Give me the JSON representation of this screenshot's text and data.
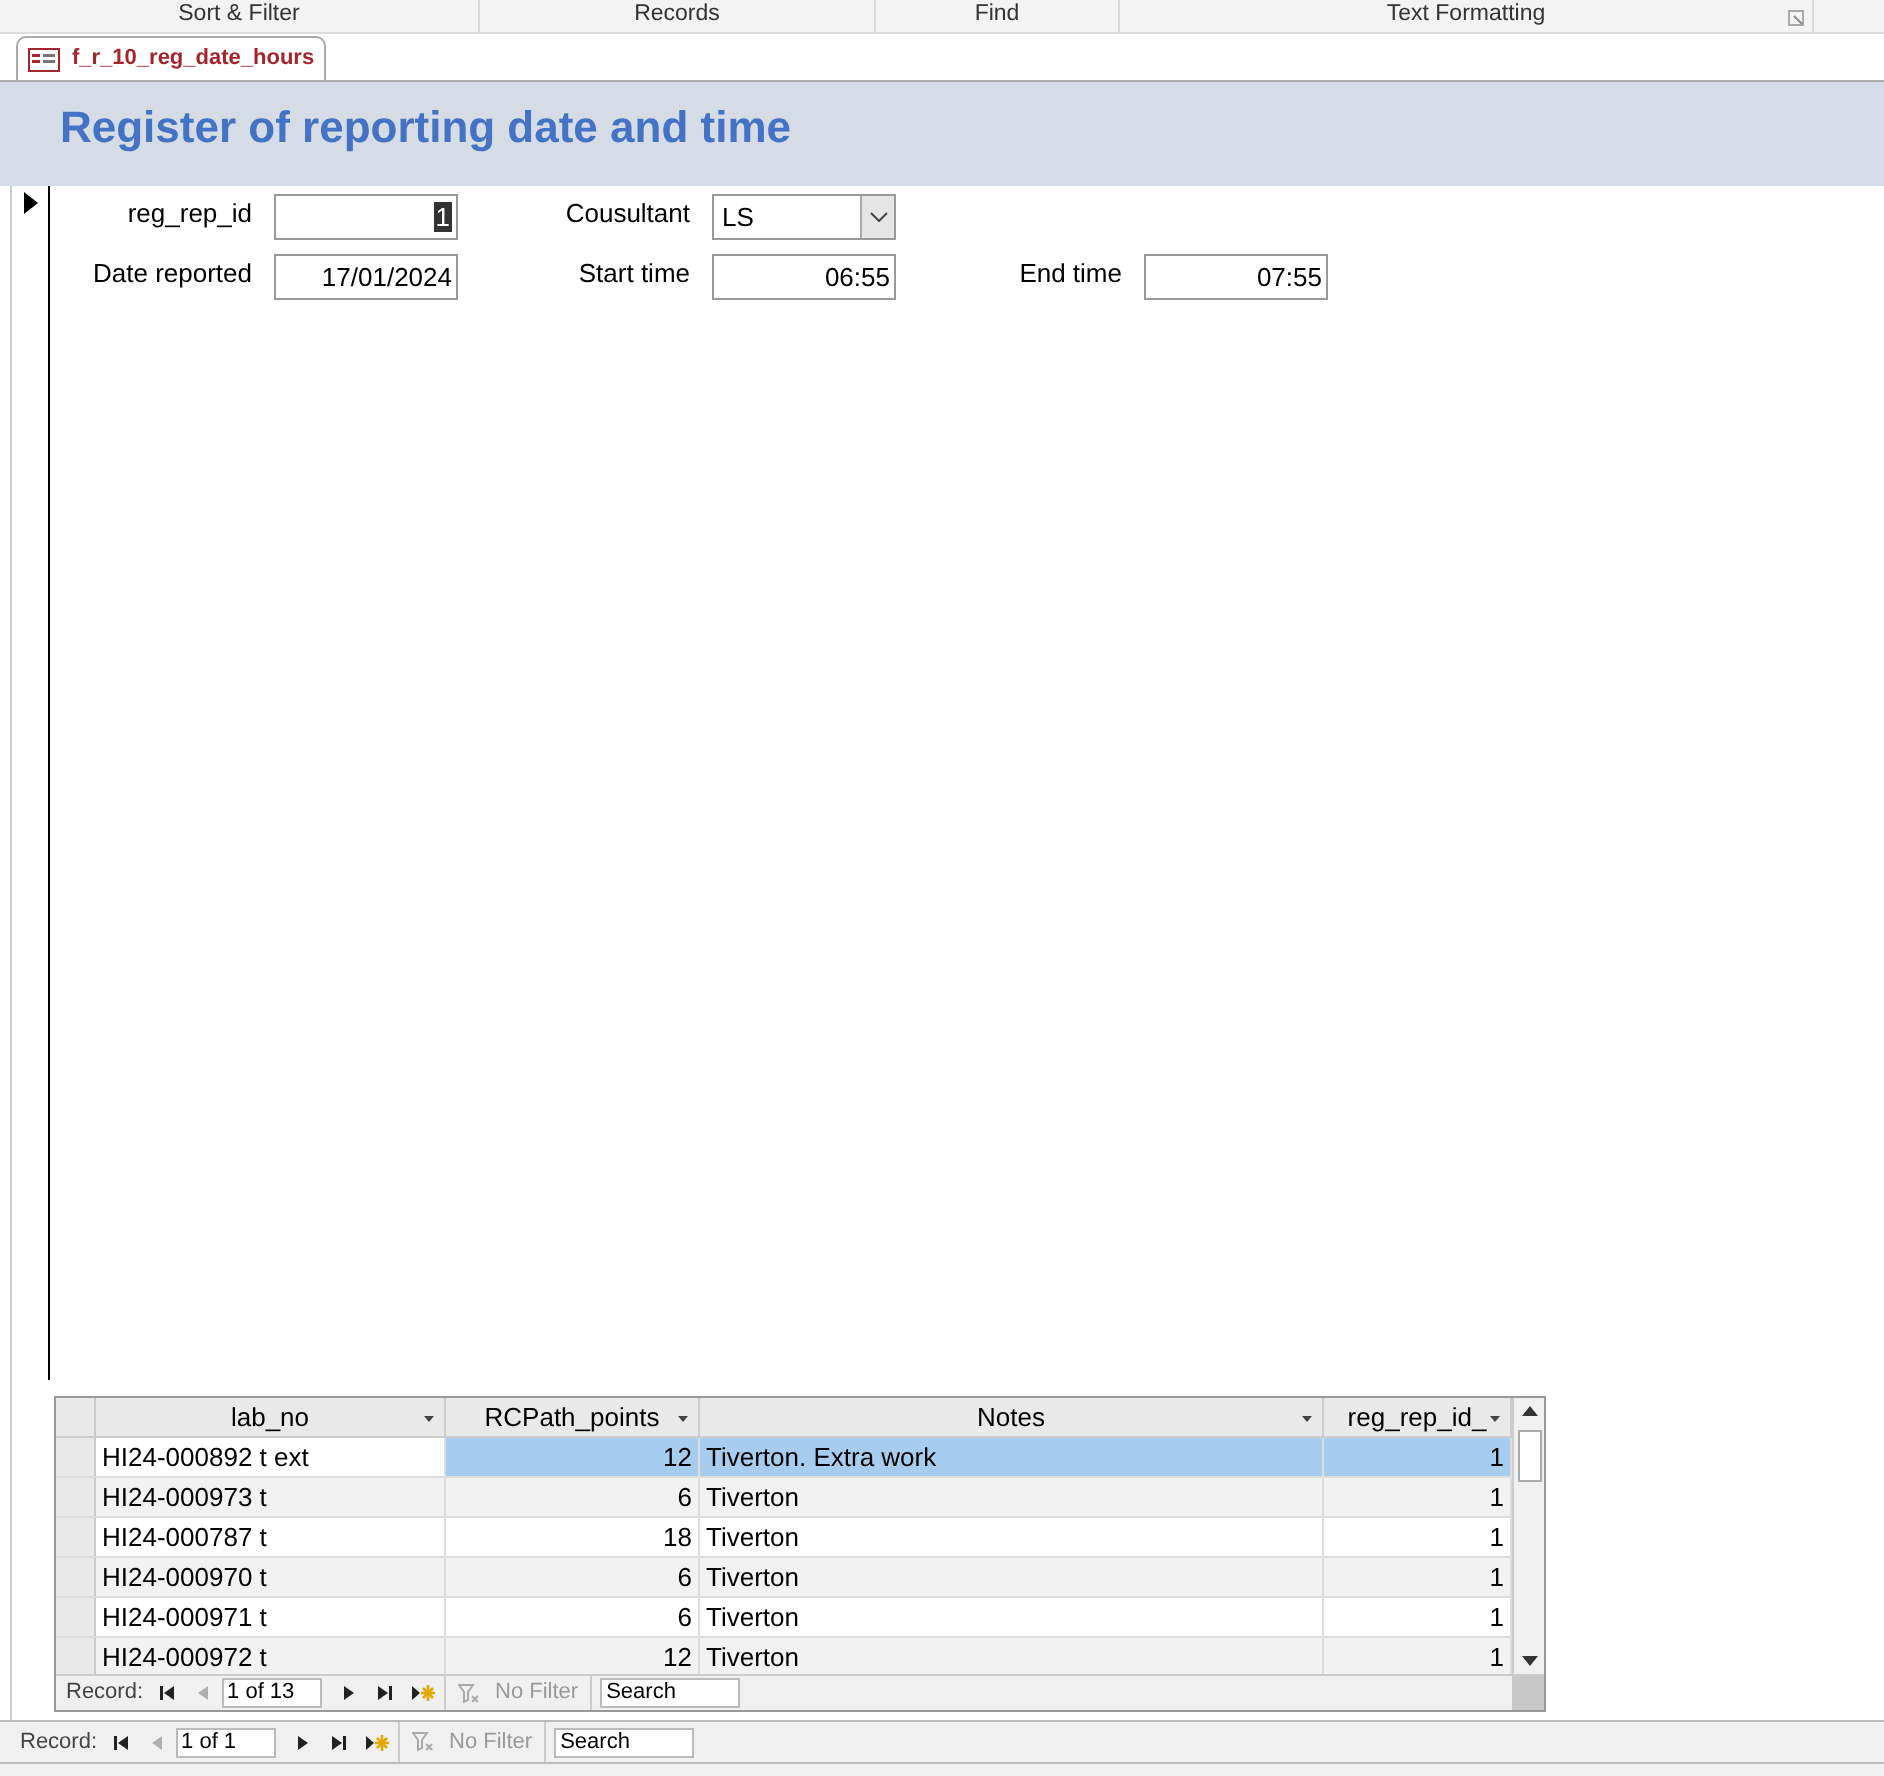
{
  "ribbon_groups": [
    {
      "label": "Sort & Filter"
    },
    {
      "label": "Records"
    },
    {
      "label": "Find"
    },
    {
      "label": "Text Formatting"
    }
  ],
  "document_tab": {
    "label": "f_r_10_reg_date_hours",
    "selected": true
  },
  "form": {
    "title": "Register of reporting date and time",
    "field_rows": [
      [
        {
          "kind": "text",
          "label": "reg_rep_id",
          "value": "1",
          "value_selected": true
        },
        {
          "kind": "combo",
          "label": "Cousultant",
          "value": "LS",
          "value_selected": false
        }
      ],
      [
        {
          "kind": "text",
          "label": "Date reported",
          "value": "17/01/2024",
          "value_selected": false
        },
        {
          "kind": "text",
          "label": "Start time",
          "value": "06:55",
          "value_selected": false
        },
        {
          "kind": "text",
          "label": "End time",
          "value": "07:55",
          "value_selected": false
        }
      ]
    ]
  },
  "subform": {
    "columns": [
      {
        "label": "lab_no"
      },
      {
        "label": "RCPath_points"
      },
      {
        "label": "Notes"
      },
      {
        "label": "reg_rep_id_"
      }
    ],
    "rows": [
      {
        "selected": true,
        "cells": [
          "HI24-000892 t ext",
          "12",
          "Tiverton. Extra work",
          "1"
        ]
      },
      {
        "selected": false,
        "cells": [
          "HI24-000973 t",
          "6",
          "Tiverton",
          "1"
        ]
      },
      {
        "selected": false,
        "cells": [
          "HI24-000787 t",
          "18",
          "Tiverton",
          "1"
        ]
      },
      {
        "selected": false,
        "cells": [
          "HI24-000970 t",
          "6",
          "Tiverton",
          "1"
        ]
      },
      {
        "selected": false,
        "cells": [
          "HI24-000971 t",
          "6",
          "Tiverton",
          "1"
        ]
      },
      {
        "selected": false,
        "cells": [
          "HI24-000972 t",
          "12",
          "Tiverton",
          "1"
        ]
      }
    ],
    "navigation": {
      "label": "Record:",
      "position": "1 of 13",
      "filter": "No Filter",
      "search_placeholder": "Search"
    }
  },
  "navigation": {
    "label": "Record:",
    "position": "1 of 1",
    "filter": "No Filter",
    "search_placeholder": "Search"
  }
}
